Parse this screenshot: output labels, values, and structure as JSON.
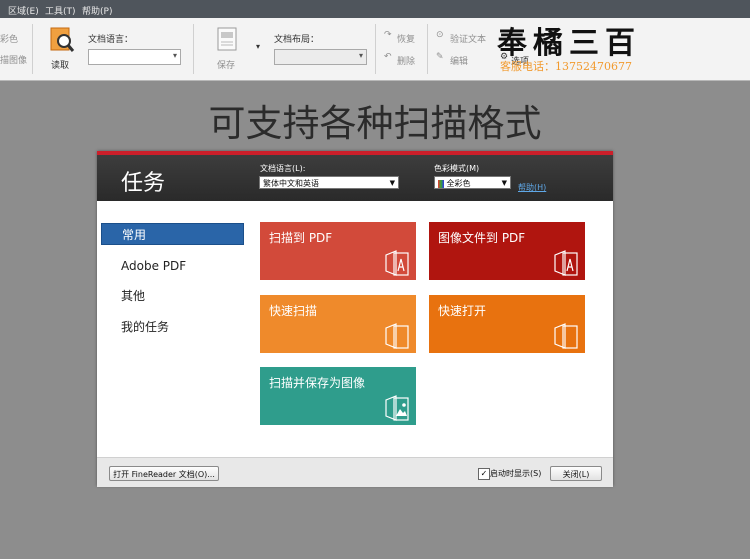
{
  "menu": {
    "items": [
      "区域(E)",
      "工具(T)",
      "帮助(P)"
    ]
  },
  "ribbon": {
    "left_partial_1": "彩色",
    "left_partial_2": "描图像",
    "read_label": "读取",
    "doc_lang_label": "文档语言：",
    "doc_lang_value": "",
    "save_label": "保存",
    "doc_layout_label": "文档布局：",
    "doc_layout_value": "",
    "restore_label": "恢复",
    "delete_label": "删除",
    "verify_text_label": "验证文本",
    "edit_label": "编辑",
    "options_label": "选项"
  },
  "watermark": {
    "brand": "奉橘三百",
    "phone": "客服电话：13752470677"
  },
  "headline": "可支持各种扫描格式",
  "dialog": {
    "title": "任务",
    "doc_lang_label": "文档语言(L):",
    "doc_lang_value": "繁体中文和英语",
    "color_mode_label": "色彩模式(M)",
    "color_mode_value": "全彩色",
    "help_link": "帮助(H)",
    "nav": [
      "常用",
      "Adobe PDF",
      "其他",
      "我的任务"
    ],
    "tiles": {
      "scan_to_pdf": "扫描到 PDF",
      "image_to_pdf": "图像文件到 PDF",
      "quick_scan": "快速扫描",
      "quick_open": "快速打开",
      "scan_save_image": "扫描并保存为图像"
    },
    "open_doc_button": "打开 FineReader 文档(O)...",
    "startup_checkbox_label": "启动时显示(S)",
    "startup_checked": true,
    "close_button": "关闭(L)"
  },
  "colors": {
    "accent_red": "#cc1f2a",
    "tile_red": "#d24a3a",
    "tile_darkred": "#b0150f",
    "tile_orange": "#ef8a2b",
    "tile_orange2": "#e8720f",
    "tile_teal": "#2f9d8c",
    "nav_active": "#2a65a8"
  }
}
